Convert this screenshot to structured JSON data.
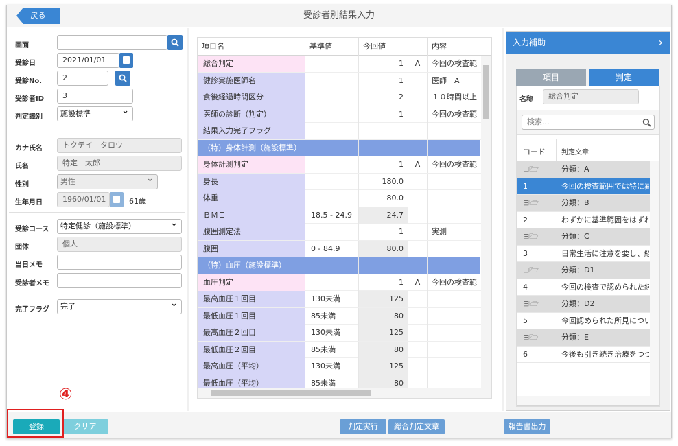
{
  "header": {
    "back": "戻る",
    "title": "受診者別結果入力"
  },
  "left": {
    "l_screen": "画面",
    "l_date": "受診日",
    "date_value": "2021/01/01",
    "l_no": "受診No.",
    "no_value": "2",
    "l_id": "受診者ID",
    "id_value": "3",
    "l_type": "判定識別",
    "type_value": "施設標準",
    "l_kana": "カナ氏名",
    "kana_value": "トクテイ　タロウ",
    "l_name": "氏名",
    "name_value": "特定　太郎",
    "l_sex": "性別",
    "sex_value": "男性",
    "l_birth": "生年月日",
    "birth_value": "1960/01/01",
    "age": "61歳",
    "l_course": "受診コース",
    "course_value": "特定健診（施設標準）",
    "l_group": "団体",
    "group_value": "個人",
    "l_daymemo": "当日メモ",
    "l_memo": "受診者メモ",
    "l_done": "完了フラグ",
    "done_value": "完了"
  },
  "grid": {
    "headers": [
      "項目名",
      "基準値",
      "今回値",
      "",
      "内容"
    ],
    "rows": [
      [
        "総合判定",
        "",
        "1",
        "A",
        "今回の検査範"
      ],
      [
        "健診実施医師名",
        "",
        "1",
        "",
        "医師　A"
      ],
      [
        "食後経過時間区分",
        "",
        "2",
        "",
        "１０時間以上"
      ],
      [
        "医師の診断（判定）",
        "",
        "1",
        "",
        "今回の検査範"
      ],
      [
        "結果入力完了フラグ",
        "",
        "",
        "",
        ""
      ],
      [
        "（特）身体計測（施設標準）",
        "",
        "",
        "",
        ""
      ],
      [
        "身体計測判定",
        "",
        "1",
        "A",
        "今回の検査範"
      ],
      [
        "身長",
        "",
        "180.0",
        "",
        ""
      ],
      [
        "体重",
        "",
        "80.0",
        "",
        ""
      ],
      [
        "ＢＭＩ",
        "18.5 - 24.9",
        "24.7",
        "",
        ""
      ],
      [
        "腹囲測定法",
        "",
        "1",
        "",
        "実測"
      ],
      [
        "腹囲",
        "0 - 84.9",
        "80.0",
        "",
        ""
      ],
      [
        "（特）血圧（施設標準）",
        "",
        "",
        "",
        ""
      ],
      [
        "血圧判定",
        "",
        "1",
        "A",
        "今回の検査範"
      ],
      [
        "最高血圧１回目",
        "130未満",
        "125",
        "",
        ""
      ],
      [
        "最低血圧１回目",
        "85未満",
        "80",
        "",
        ""
      ],
      [
        "最高血圧２回目",
        "130未満",
        "125",
        "",
        ""
      ],
      [
        "最低血圧２回目",
        "85未満",
        "80",
        "",
        ""
      ],
      [
        "最高血圧（平均）",
        "130未満",
        "125",
        "",
        ""
      ],
      [
        "最低血圧（平均）",
        "85未満",
        "80",
        "",
        ""
      ]
    ]
  },
  "assist": {
    "title": "入力補助",
    "tab1": "項目",
    "tab2": "判定",
    "name_label": "名称",
    "name_value": "総合判定",
    "search_placeholder": "検索...",
    "col1": "コード",
    "col2": "判定文章",
    "items": [
      [
        "",
        "分類：A"
      ],
      [
        "1",
        "今回の検査範囲では特に異"
      ],
      [
        "",
        "分類：B"
      ],
      [
        "2",
        "わずかに基準範囲をはずれ"
      ],
      [
        "",
        "分類：C"
      ],
      [
        "3",
        "日常生活に注意を要し、経"
      ],
      [
        "",
        "分類：D1"
      ],
      [
        "4",
        "今回の検査で認められた結"
      ],
      [
        "",
        "分類：D2"
      ],
      [
        "5",
        "今回認められた所見につい"
      ],
      [
        "",
        "分類：E"
      ],
      [
        "6",
        "今後も引き続き治療をつづ"
      ]
    ]
  },
  "footer": {
    "register": "登録",
    "clear": "クリア",
    "judge": "判定実行",
    "summary": "総合判定文章",
    "report": "報告書出力",
    "annotation": "④"
  },
  "colors": {
    "pink": "#fde3f5",
    "lav": "#d6d6f7",
    "section": "#7f9fe2",
    "blue": "#3a86d4",
    "teal": "#1aaab9"
  }
}
